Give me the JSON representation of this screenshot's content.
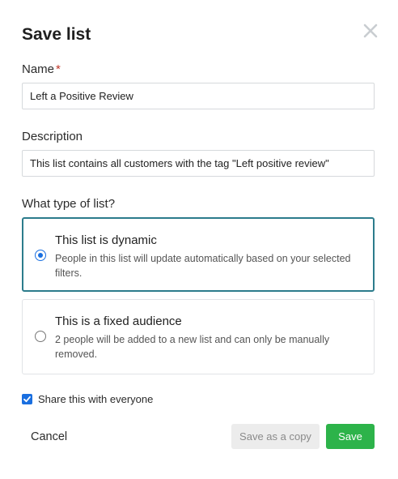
{
  "dialog": {
    "title": "Save list",
    "close_icon": "close-icon"
  },
  "name_field": {
    "label": "Name",
    "required_mark": "*",
    "value": "Left a Positive Review"
  },
  "description_field": {
    "label": "Description",
    "value": "This list contains all customers with the tag \"Left positive review\""
  },
  "list_type": {
    "question": "What type of list?",
    "options": [
      {
        "title": "This list is dynamic",
        "description": "People in this list will update automatically based on your selected filters.",
        "selected": true
      },
      {
        "title": "This is a fixed audience",
        "description": "2 people will be added to a new list and can only be manually removed.",
        "selected": false
      }
    ]
  },
  "share": {
    "label": "Share this with everyone",
    "checked": true
  },
  "footer": {
    "cancel_label": "Cancel",
    "save_copy_label": "Save as a copy",
    "save_label": "Save"
  },
  "colors": {
    "accent_border": "#2c7c8c",
    "radio_checkbox_blue": "#1a6fe0",
    "save_green": "#2db34a",
    "required_red": "#c0392b"
  }
}
